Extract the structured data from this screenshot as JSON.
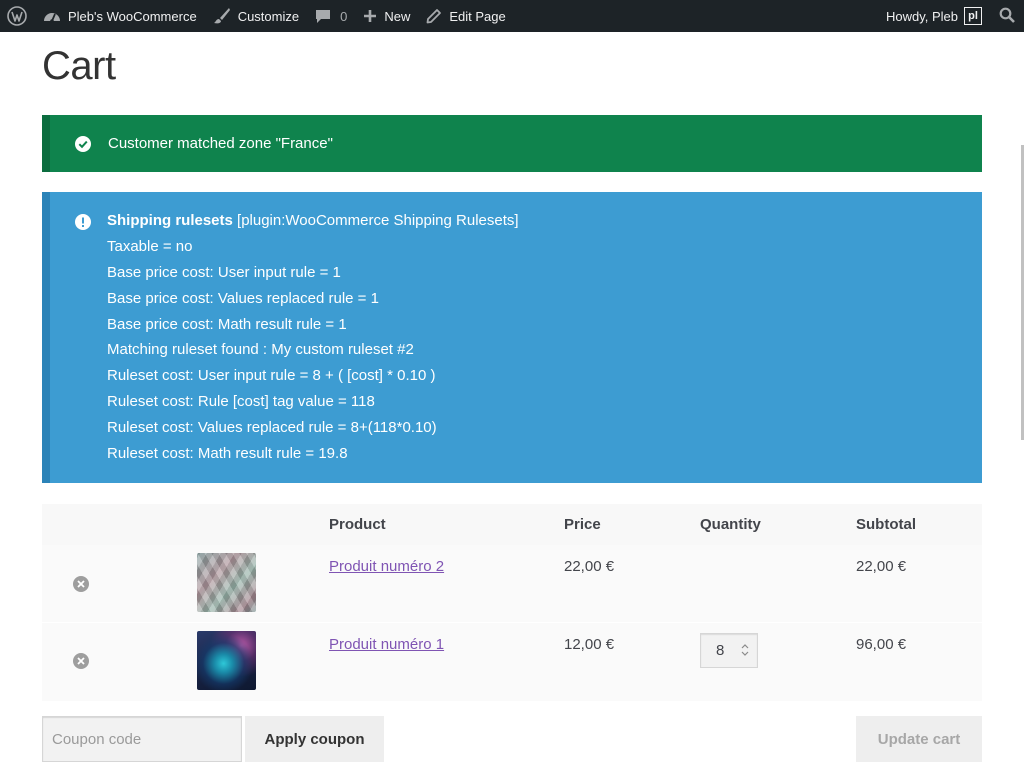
{
  "adminbar": {
    "site_name": "Pleb's WooCommerce",
    "customize": "Customize",
    "comments_count": "0",
    "new": "New",
    "edit_page": "Edit Page",
    "howdy": "Howdy, Pleb",
    "avatar_text": "pl"
  },
  "page": {
    "title": "Cart"
  },
  "notice_success": {
    "text": "Customer matched zone \"France\""
  },
  "notice_info": {
    "title_bold": "Shipping rulesets",
    "title_rest": " [plugin:WooCommerce Shipping Rulesets]",
    "lines": [
      "Taxable = no",
      "Base price cost: User input rule = 1",
      "Base price cost: Values replaced rule = 1",
      "Base price cost: Math result rule = 1",
      "Matching ruleset found : My custom ruleset #2",
      "Ruleset cost: User input rule = 8 + ( [cost] * 0.10 )",
      "Ruleset cost: Rule [cost] tag value = 118",
      "Ruleset cost: Values replaced rule = 8+(118*0.10)",
      "Ruleset cost: Math result rule = 19.8"
    ]
  },
  "cart": {
    "headers": {
      "product": "Product",
      "price": "Price",
      "quantity": "Quantity",
      "subtotal": "Subtotal"
    },
    "rows": [
      {
        "product": "Produit numéro 2",
        "price": "22,00 €",
        "quantity": "",
        "subtotal": "22,00 €"
      },
      {
        "product": "Produit numéro 1",
        "price": "12,00 €",
        "quantity": "8",
        "subtotal": "96,00 €"
      }
    ]
  },
  "actions": {
    "coupon_placeholder": "Coupon code",
    "apply_coupon": "Apply coupon",
    "update_cart": "Update cart"
  },
  "colors": {
    "success": "#0f834d",
    "info": "#3d9cd2",
    "link": "#7f54b3",
    "adminbar": "#1d2327"
  },
  "icons": [
    "wordpress-icon",
    "dashboard-icon",
    "brush-icon",
    "comment-icon",
    "plus-icon",
    "pencil-icon",
    "search-icon",
    "check-circle-icon",
    "info-icon",
    "remove-icon"
  ]
}
